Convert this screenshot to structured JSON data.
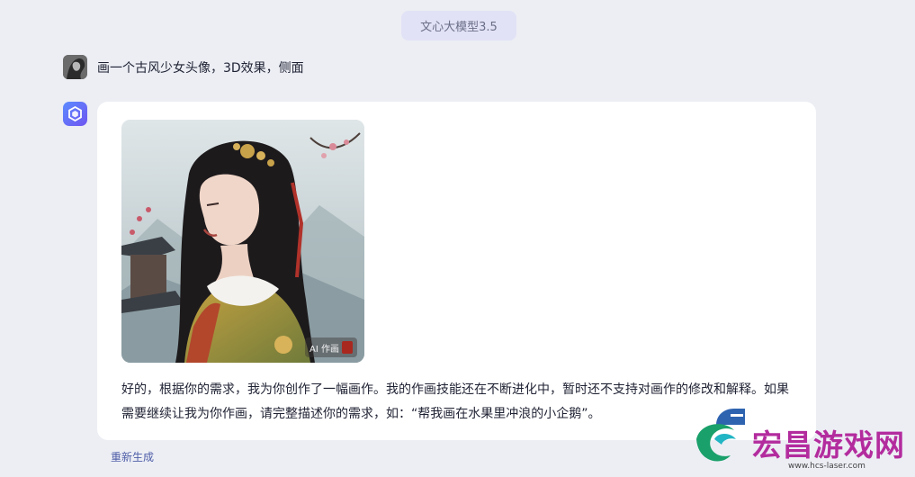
{
  "model_pill": {
    "label": "文心大模型3.5"
  },
  "user_message": {
    "text": "画一个古风少女头像，3D效果，侧面"
  },
  "bot_reply": {
    "image_badge": "AI 作画",
    "text": "好的，根据你的需求，我为你创作了一幅画作。我的作画技能还在不断进化中，暂时还不支持对画作的修改和解释。如果需要继续让我为你作画，请完整描述你的需求，如：“帮我画在水果里冲浪的小企鹅”。"
  },
  "actions": {
    "regenerate_label": "重新生成"
  },
  "watermark": {
    "title": "宏昌游戏网",
    "url": "www.hcs-laser.com"
  },
  "colors": {
    "background": "#eceef4",
    "card": "#ffffff",
    "pill": "#e2e2f6",
    "link": "#4f5ea8",
    "watermark": "#b32c9e"
  }
}
